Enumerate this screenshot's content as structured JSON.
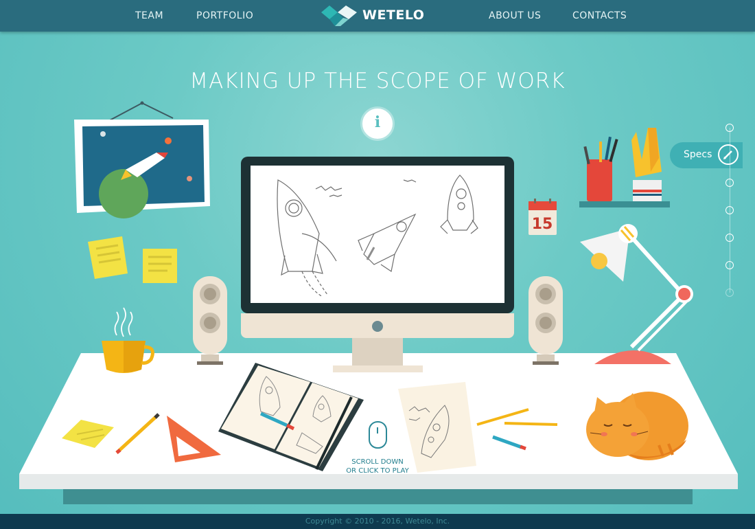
{
  "header": {
    "nav_left": [
      "TEAM",
      "PORTFOLIO"
    ],
    "nav_right": [
      "ABOUT US",
      "CONTACTS"
    ],
    "logo_text": "WETELO",
    "logo_icon": "wetelo-logo-icon"
  },
  "hero": {
    "title": "MAKING UP THE SCOPE OF WORK",
    "info_icon": "info-icon",
    "info_glyph": "i"
  },
  "calendar": {
    "day": "15"
  },
  "specs_tab": {
    "label": "Specs",
    "icon": "pencil-icon"
  },
  "section_dots": {
    "count": 7,
    "active_index": 1
  },
  "scroll_hint": {
    "line1": "SCROLL DOWN",
    "line2": "OR CLICK TO PLAY",
    "icon": "mouse-icon"
  },
  "footer": {
    "copyright": "Copyright © 2010 - 2016, Wetelo, Inc."
  },
  "colors": {
    "header_bg": "#2a6c7e",
    "background": "#6ccac6",
    "accent": "#3fb0b4",
    "footer_bg": "#0e3a4f"
  }
}
